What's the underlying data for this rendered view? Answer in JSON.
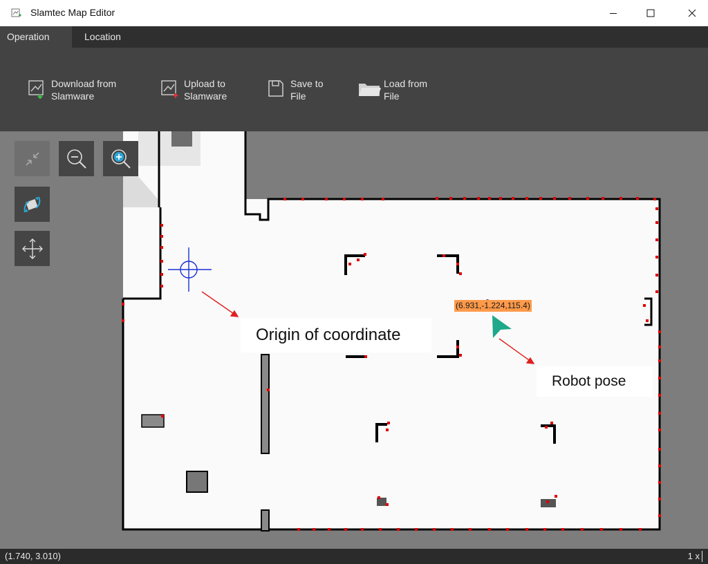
{
  "window": {
    "title": "Slamtec Map Editor",
    "icons": {
      "app": "map-editor-icon",
      "minimize": "minimize-icon",
      "maximize": "maximize-icon",
      "close": "close-icon"
    }
  },
  "tabs": [
    {
      "label": "Operation",
      "active": true
    },
    {
      "label": "Location",
      "active": false
    }
  ],
  "ribbon": {
    "download": {
      "label": "Download from\nSlamware",
      "icon": "download-icon"
    },
    "upload": {
      "label": "Upload to\nSlamware",
      "icon": "upload-icon"
    },
    "save": {
      "label": "Save to\nFile",
      "icon": "save-icon"
    },
    "load": {
      "label": "Load from\nFile",
      "icon": "folder-icon"
    }
  },
  "tools": {
    "fit": {
      "icon": "fit-view-icon",
      "enabled": false
    },
    "zoom_out": {
      "icon": "zoom-out-icon"
    },
    "zoom_in": {
      "icon": "zoom-in-icon"
    },
    "relocate": {
      "icon": "relocate-robot-icon"
    },
    "pan": {
      "icon": "pan-move-icon"
    }
  },
  "map": {
    "robot_pose_label": "(6.931,-1.224,115.4)",
    "annotations": {
      "origin": "Origin of coordinate",
      "robot": "Robot pose"
    },
    "colors": {
      "free_space": "#fafafa",
      "unknown": "#7d7d7d",
      "wall": "#000000",
      "laser_points": "#e00000",
      "origin_marker": "#1a2fd6",
      "robot": "#1fa88a",
      "pose_label_bg": "#ff9a4a",
      "arrow": "#e02020"
    }
  },
  "status": {
    "coords": "(1.740, 3.010)",
    "zoom": "1 x"
  }
}
